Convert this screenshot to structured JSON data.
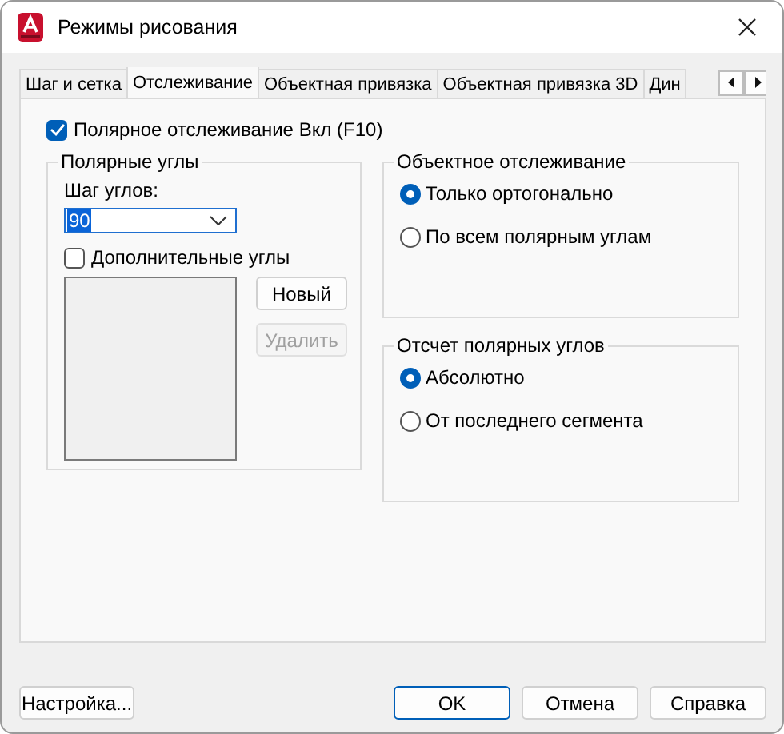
{
  "window": {
    "title": "Режимы рисования"
  },
  "tabs": [
    {
      "label": "Шаг и сетка",
      "selected": false
    },
    {
      "label": "Отслеживание",
      "selected": true
    },
    {
      "label": "Объектная привязка",
      "selected": false
    },
    {
      "label": "Объектная привязка 3D",
      "selected": false
    },
    {
      "label": "Дин",
      "selected": false
    }
  ],
  "polar_tracking": {
    "label": "Полярное отслеживание Вкл (F10)",
    "checked": true
  },
  "polar_angles": {
    "title": "Полярные углы",
    "step_label": "Шаг углов:",
    "step_value": "90",
    "additional": {
      "label": "Дополнительные углы",
      "checked": false
    },
    "buttons": [
      {
        "label": "Новый",
        "disabled": false
      },
      {
        "label": "Удалить",
        "disabled": true
      }
    ]
  },
  "object_tracking": {
    "title": "Объектное отслеживание",
    "options": [
      {
        "label": "Только ортогонально",
        "selected": true
      },
      {
        "label": "По всем полярным углам",
        "selected": false
      }
    ]
  },
  "angle_measurement": {
    "title": "Отсчет полярных углов",
    "options": [
      {
        "label": "Абсолютно",
        "selected": true
      },
      {
        "label": "От последнего сегмента",
        "selected": false
      }
    ]
  },
  "settings_button": "Настройка...",
  "buttons": [
    {
      "label": "OK",
      "default": true
    },
    {
      "label": "Отмена",
      "default": false
    },
    {
      "label": "Справка",
      "default": false
    }
  ]
}
